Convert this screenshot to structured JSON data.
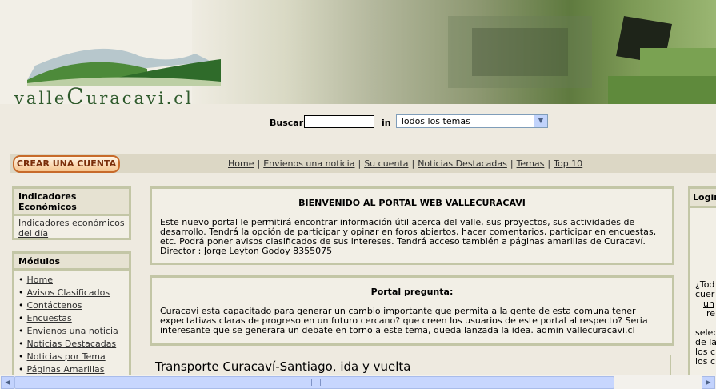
{
  "header": {
    "logo_small_prefix": "valle",
    "logo_big": "C",
    "logo_suffix": "uracavi.cl"
  },
  "search": {
    "label": "Buscar",
    "in_label": "in",
    "topic_selected": "Todos los temas",
    "value": ""
  },
  "nav": {
    "create_account": "CREAR UNA CUENTA",
    "links": [
      "Home",
      "Envienos una noticia",
      "Su cuenta",
      "Noticias Destacadas",
      "Temas",
      "Top 10"
    ]
  },
  "sidebar": {
    "indicators_title": "Indicadores Económicos",
    "indicators_link": "Indicadores económicos del día",
    "modules_title": "Módulos",
    "modules": [
      "Home",
      "Avisos Clasificados",
      "Contáctenos",
      "Encuestas",
      "Envienos una noticia",
      "Noticias Destacadas",
      "Noticias por Tema",
      "Páginas Amarillas"
    ]
  },
  "welcome": {
    "title": "BIENVENIDO AL PORTAL WEB VALLECURACAVI",
    "text": "Este nuevo portal le permitirá encontrar información útil acerca del valle, sus proyectos, sus actividades de desarrollo. Tendrá la opción de participar y opinar en foros abiertos, hacer comentarios, participar en encuestas, etc. Podrá poner avisos clasificados de sus intereses. Tendrá acceso también a páginas amarillas de Curacaví. Director : Jorge Leyton Godoy 8355075"
  },
  "question": {
    "title": "Portal pregunta:",
    "text": "Curacavi esta capacitado para generar un cambio importante que permita a la gente de esta comuna tener expectativas claras de progreso en un futuro cercano? que creen los usuarios de este portal al respecto? Seria interesante que se generara un debate en torno a este tema, queda lanzada la idea. admin vallecuracavi.cl"
  },
  "article": {
    "title": "Transporte Curacaví-Santiago, ida y vuelta"
  },
  "right": {
    "title": "Login",
    "lines": [
      "¿Tod",
      "cuer",
      "un",
      "re",
      "",
      "selec",
      "de la",
      "los c",
      "los c"
    ]
  },
  "colors": {
    "accent_green": "#2f5a2c",
    "box_border": "#c3c6a6",
    "button_border": "#c76a2a"
  }
}
